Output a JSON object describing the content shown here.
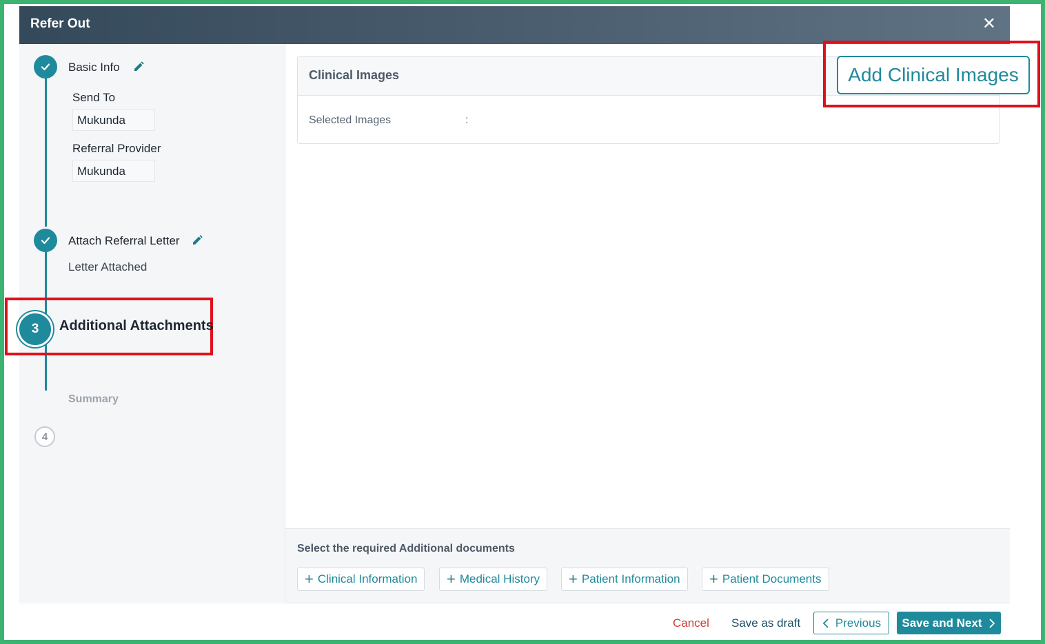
{
  "dialog": {
    "title": "Refer Out"
  },
  "stepper": {
    "step1": {
      "label": "Basic Info",
      "send_to_label": "Send To",
      "send_to_value": "Mukunda",
      "provider_label": "Referral Provider",
      "provider_value": "Mukunda"
    },
    "step2": {
      "label": "Attach Referral Letter",
      "status": "Letter Attached"
    },
    "step3": {
      "number": "3",
      "label": "Additional Attachments"
    },
    "step4": {
      "number": "4",
      "label": "Summary"
    }
  },
  "clinical_images": {
    "title": "Clinical Images",
    "selected_label": "Selected Images",
    "selected_sep": ":",
    "add_button": "Add Clinical Images"
  },
  "additional_docs": {
    "title": "Select the required Additional documents",
    "options": [
      "Clinical Information",
      "Medical History",
      "Patient Information",
      "Patient Documents"
    ]
  },
  "footer": {
    "cancel": "Cancel",
    "save_draft": "Save as draft",
    "previous": "Previous",
    "save_next": "Save and Next"
  },
  "colors": {
    "accent": "#1f8a9b",
    "highlight": "#e0101b",
    "frame": "#3cb371",
    "cancel": "#d43a3a"
  }
}
